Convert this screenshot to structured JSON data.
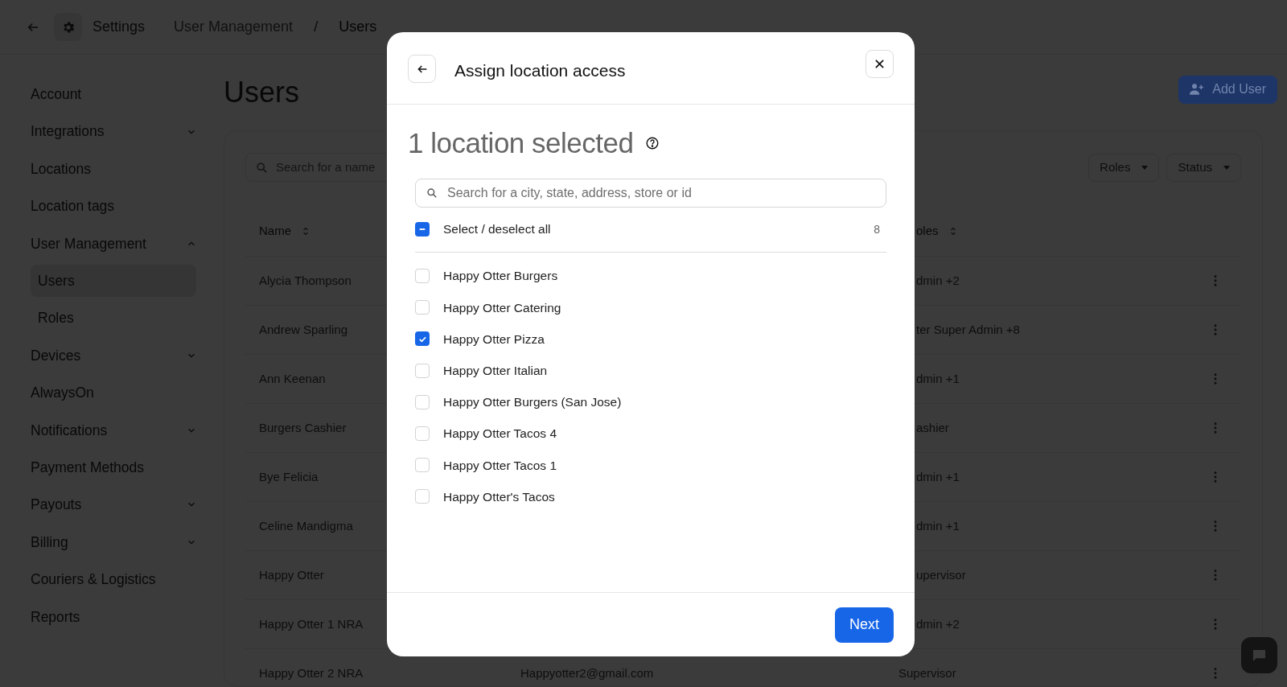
{
  "top_bar": {
    "title": "Settings",
    "breadcrumbs": [
      {
        "label": "User Management",
        "current": false
      },
      {
        "label": "Users",
        "current": true
      }
    ],
    "separator": "/"
  },
  "sidebar": {
    "items": [
      {
        "label": "Account",
        "kind": "link"
      },
      {
        "label": "Integrations",
        "kind": "group",
        "expanded": false
      },
      {
        "label": "Locations",
        "kind": "link"
      },
      {
        "label": "Location tags",
        "kind": "link"
      },
      {
        "label": "User Management",
        "kind": "group",
        "expanded": true,
        "children": [
          {
            "label": "Users",
            "selected": true
          },
          {
            "label": "Roles",
            "selected": false
          }
        ]
      },
      {
        "label": "Devices",
        "kind": "group",
        "expanded": false
      },
      {
        "label": "AlwaysOn",
        "kind": "link"
      },
      {
        "label": "Notifications",
        "kind": "group",
        "expanded": false
      },
      {
        "label": "Payment Methods",
        "kind": "link"
      },
      {
        "label": "Payouts",
        "kind": "group",
        "expanded": false
      },
      {
        "label": "Billing",
        "kind": "group",
        "expanded": false
      },
      {
        "label": "Couriers & Logistics",
        "kind": "link"
      },
      {
        "label": "Reports",
        "kind": "link"
      }
    ]
  },
  "page": {
    "title": "Users",
    "add_button": "Add User",
    "search": {
      "placeholder": "Search for a name"
    },
    "filters": [
      "Roles",
      "Status"
    ]
  },
  "table": {
    "columns": [
      "Name",
      "oles"
    ],
    "rows": [
      {
        "name": "Alycia Thompson",
        "role": "dmin +2",
        "under_dialog": true
      },
      {
        "name": "Andrew Sparling",
        "role": "ter Super Admin +8",
        "under_dialog": true
      },
      {
        "name": "Ann Keenan",
        "role": "dmin +1",
        "under_dialog": true
      },
      {
        "name": "Burgers Cashier",
        "role": "ashier",
        "under_dialog": true
      },
      {
        "name": "Bye Felicia",
        "role": "dmin +1",
        "under_dialog": true
      },
      {
        "name": "Celine Mandigma",
        "role": "dmin +1",
        "under_dialog": true
      },
      {
        "name": "Happy Otter",
        "role": "upervisor",
        "under_dialog": true
      },
      {
        "name": "Happy Otter 1 NRA",
        "role": "dmin +2",
        "under_dialog": true
      },
      {
        "name": "Happy Otter 2 NRA",
        "email": "Happyotter2@gmail.com",
        "role": "Supervisor"
      }
    ]
  },
  "dialog": {
    "title": "Assign location access",
    "heading": "1 location selected",
    "search": {
      "placeholder": "Search for a city, state, address, store or id"
    },
    "select_all": {
      "label": "Select / deselect all",
      "indeterminate": true,
      "count": "8"
    },
    "locations": [
      {
        "label": "Happy Otter Burgers",
        "checked": false
      },
      {
        "label": "Happy Otter Catering",
        "checked": false
      },
      {
        "label": "Happy Otter Pizza",
        "checked": true
      },
      {
        "label": "Happy Otter Italian",
        "checked": false
      },
      {
        "label": "Happy Otter Burgers (San Jose)",
        "checked": false
      },
      {
        "label": "Happy Otter Tacos 4",
        "checked": false
      },
      {
        "label": "Happy Otter Tacos 1",
        "checked": false
      },
      {
        "label": "Happy Otter's Tacos",
        "checked": false
      }
    ],
    "next_button": "Next"
  }
}
